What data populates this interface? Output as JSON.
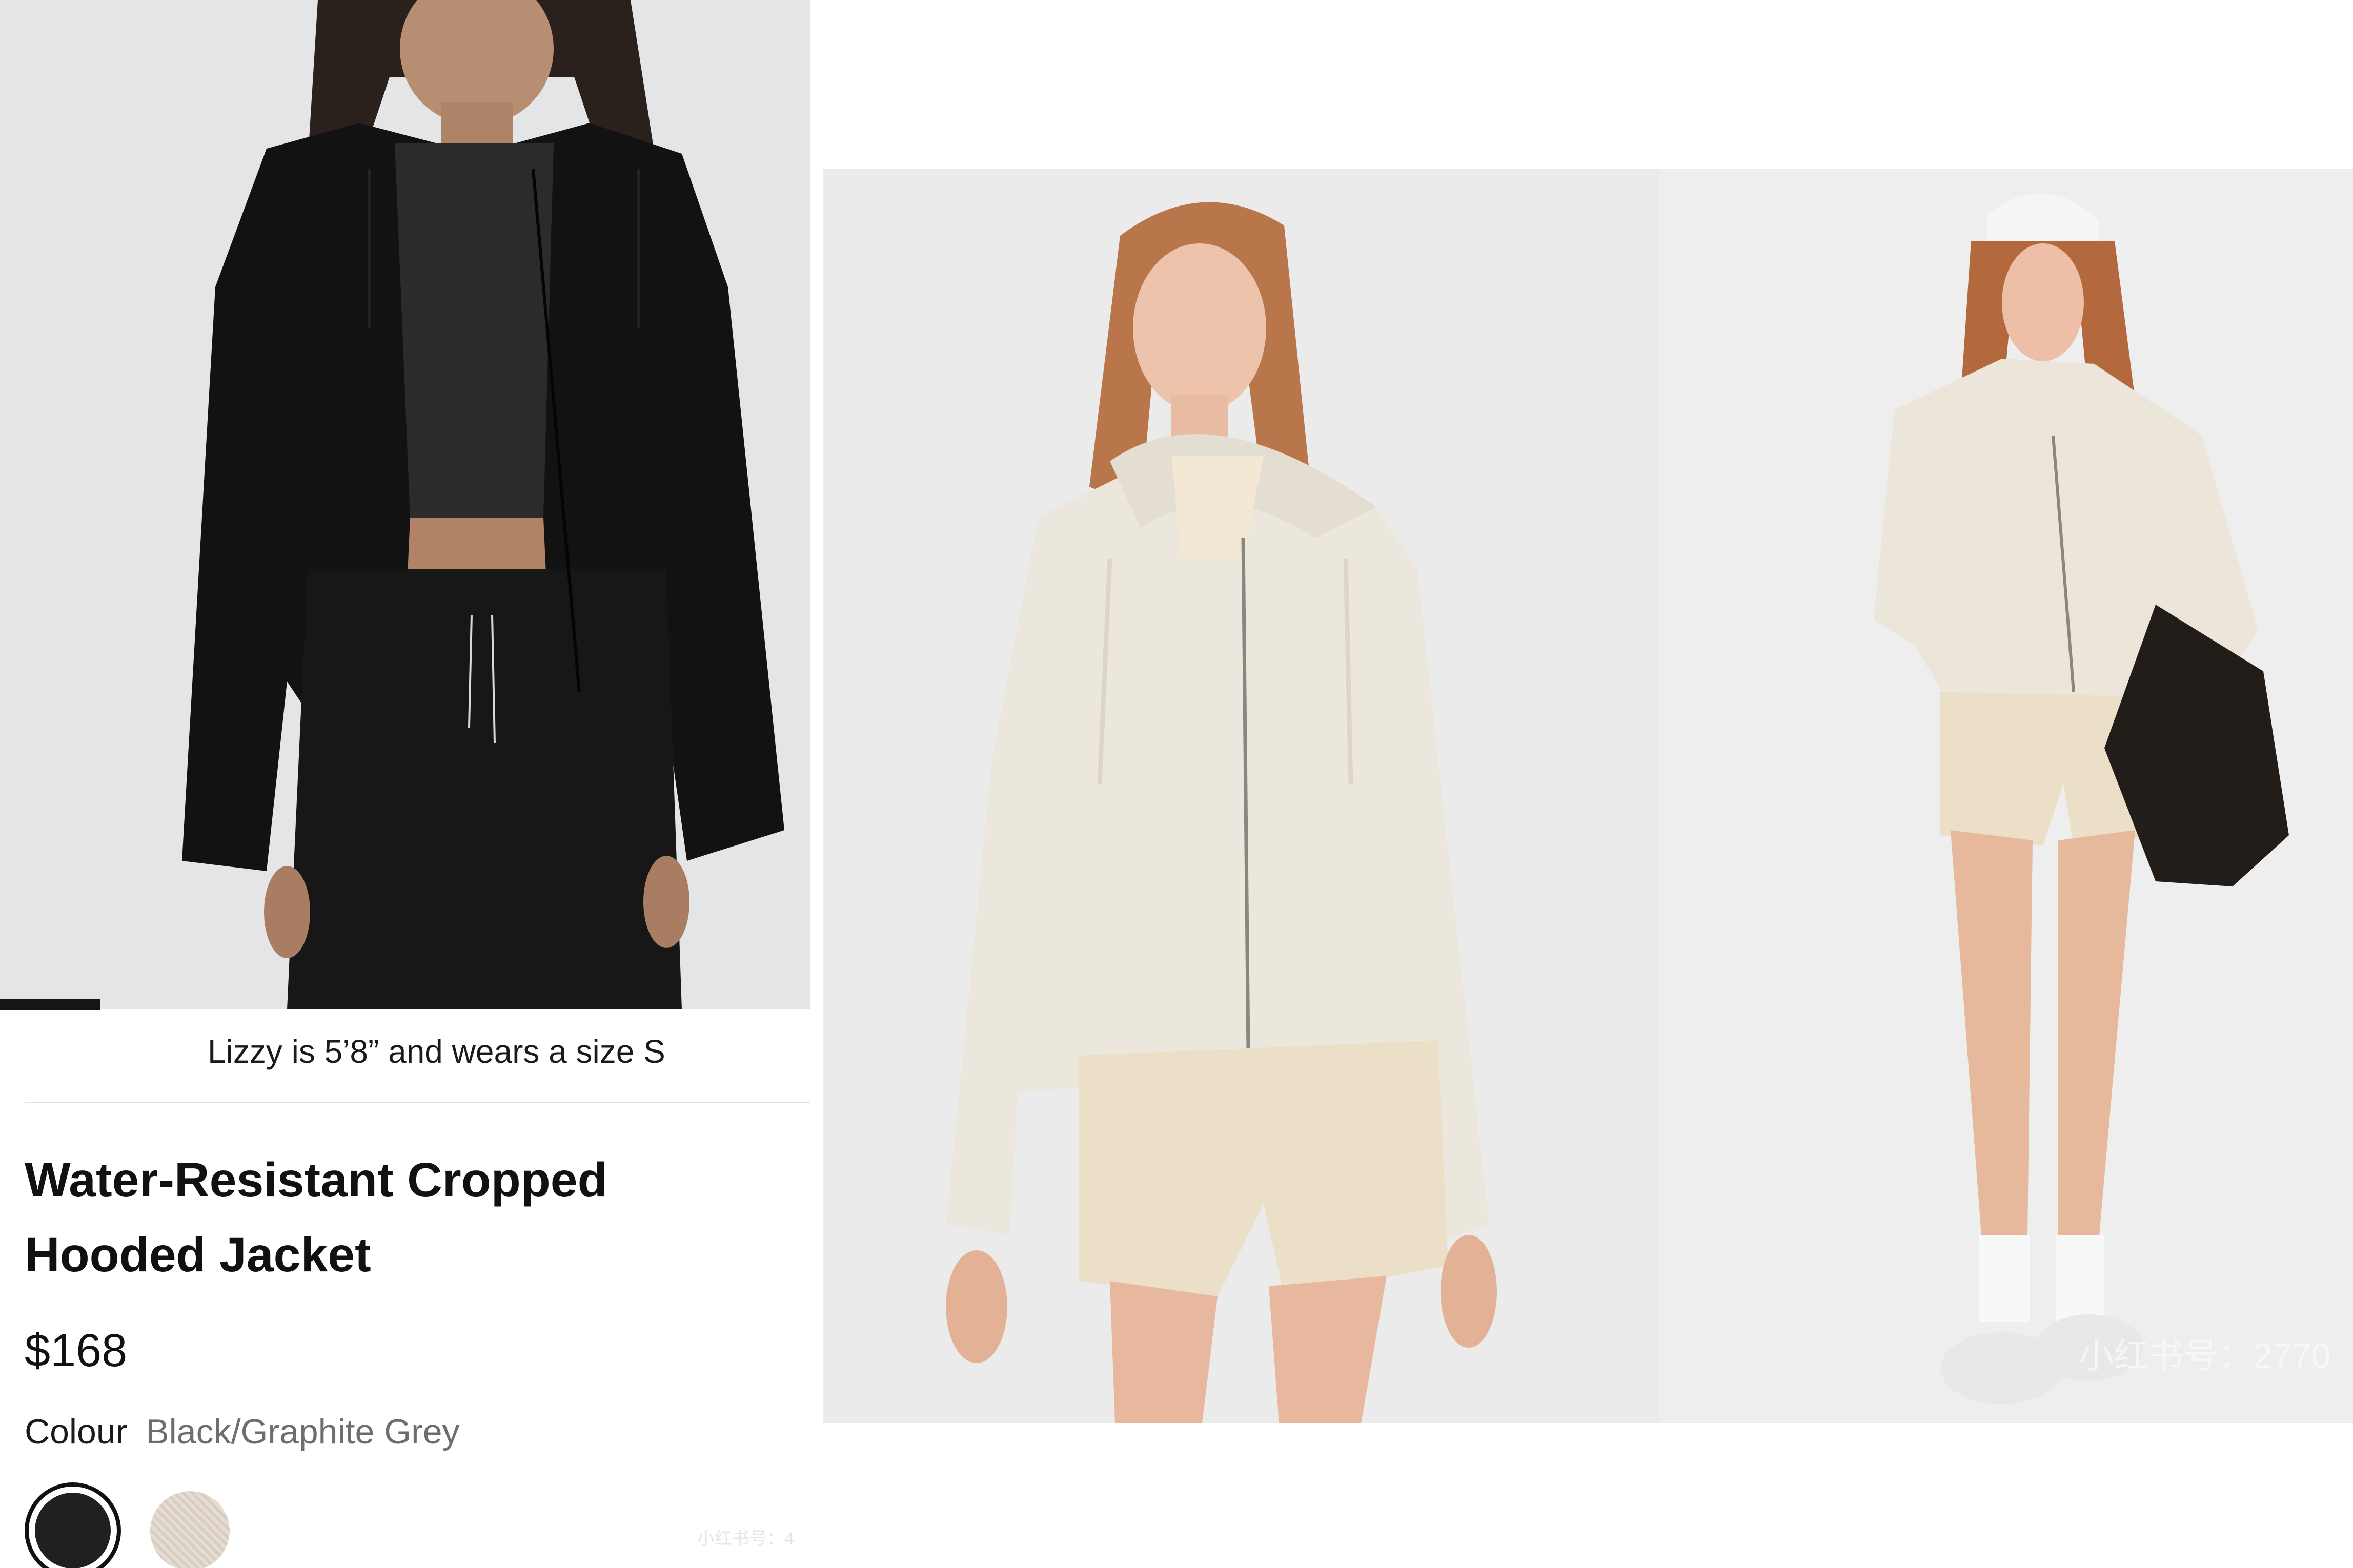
{
  "product_image": {
    "alt": "Model wearing black cropped hooded jacket"
  },
  "lifestyle_image": {
    "alt": "Models wearing bone cropped hooded jacket with shorts"
  },
  "product": {
    "model_caption": "Lizzy is 5’8” and wears a size S",
    "title": "Water-Resistant Cropped Hooded Jacket",
    "price": "$168",
    "colour_label": "Colour",
    "colour_value": "Black/Graphite Grey",
    "swatches": [
      {
        "name": "Black/Graphite Grey",
        "color": "#202020",
        "selected": true
      },
      {
        "name": "Bone",
        "color": "#e0d6cb",
        "selected": false
      }
    ]
  },
  "watermarks": {
    "small": "小红书号：4",
    "large": "小红书号：2770"
  }
}
